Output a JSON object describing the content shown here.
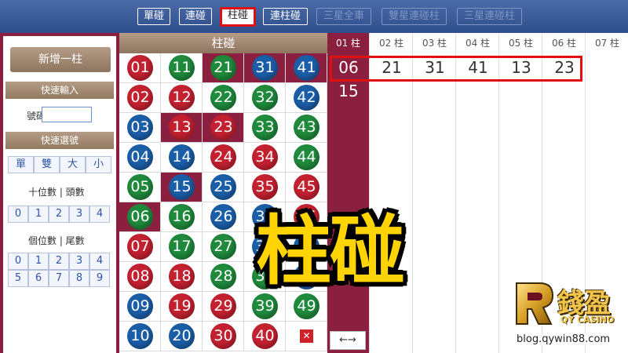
{
  "tabs": [
    {
      "label": "單碰",
      "state": "normal"
    },
    {
      "label": "連碰",
      "state": "normal"
    },
    {
      "label": "柱碰",
      "state": "active"
    },
    {
      "label": "連柱碰",
      "state": "normal"
    },
    {
      "label": "三星全車",
      "state": "disabled"
    },
    {
      "label": "雙星連碰柱",
      "state": "disabled"
    },
    {
      "label": "三星連碰柱",
      "state": "disabled"
    }
  ],
  "left": {
    "add_button": "新增一柱",
    "quick_input_title": "快速輸入",
    "number_label": "號碼",
    "number_value": "",
    "quick_pick_title": "快速選號",
    "parity_buttons": [
      "單",
      "雙",
      "大",
      "小"
    ],
    "tens_label": "十位數 | 頭數",
    "tens_buttons": [
      "0",
      "1",
      "2",
      "3",
      "4"
    ],
    "units_label": "個位數 | 尾數",
    "units_buttons": [
      "0",
      "1",
      "2",
      "3",
      "4",
      "5",
      "6",
      "7",
      "8",
      "9"
    ]
  },
  "grid": {
    "title": "柱碰",
    "rows": [
      [
        {
          "n": "01",
          "c": "red"
        },
        {
          "n": "11",
          "c": "green"
        },
        {
          "n": "21",
          "c": "green",
          "sel": true
        },
        {
          "n": "31",
          "c": "blue",
          "sel": true
        },
        {
          "n": "41",
          "c": "blue",
          "sel": true
        }
      ],
      [
        {
          "n": "02",
          "c": "red"
        },
        {
          "n": "12",
          "c": "red"
        },
        {
          "n": "22",
          "c": "green"
        },
        {
          "n": "32",
          "c": "green"
        },
        {
          "n": "42",
          "c": "blue"
        }
      ],
      [
        {
          "n": "03",
          "c": "blue"
        },
        {
          "n": "13",
          "c": "red",
          "sel": true
        },
        {
          "n": "23",
          "c": "red",
          "sel": true
        },
        {
          "n": "33",
          "c": "green"
        },
        {
          "n": "43",
          "c": "green"
        }
      ],
      [
        {
          "n": "04",
          "c": "blue"
        },
        {
          "n": "14",
          "c": "blue"
        },
        {
          "n": "24",
          "c": "red"
        },
        {
          "n": "34",
          "c": "red"
        },
        {
          "n": "44",
          "c": "green"
        }
      ],
      [
        {
          "n": "05",
          "c": "green"
        },
        {
          "n": "15",
          "c": "blue",
          "sel": true
        },
        {
          "n": "25",
          "c": "blue"
        },
        {
          "n": "35",
          "c": "red"
        },
        {
          "n": "45",
          "c": "red"
        }
      ],
      [
        {
          "n": "06",
          "c": "green",
          "sel": true
        },
        {
          "n": "16",
          "c": "green"
        },
        {
          "n": "26",
          "c": "blue"
        },
        {
          "n": "36",
          "c": "blue"
        },
        {
          "n": "46",
          "c": "red"
        }
      ],
      [
        {
          "n": "07",
          "c": "red"
        },
        {
          "n": "17",
          "c": "green"
        },
        {
          "n": "27",
          "c": "green"
        },
        {
          "n": "37",
          "c": "blue"
        },
        {
          "n": "47",
          "c": "blue"
        }
      ],
      [
        {
          "n": "08",
          "c": "red"
        },
        {
          "n": "18",
          "c": "red"
        },
        {
          "n": "28",
          "c": "green"
        },
        {
          "n": "38",
          "c": "green"
        },
        {
          "n": "48",
          "c": "blue"
        }
      ],
      [
        {
          "n": "09",
          "c": "blue"
        },
        {
          "n": "19",
          "c": "red"
        },
        {
          "n": "29",
          "c": "red"
        },
        {
          "n": "39",
          "c": "green"
        },
        {
          "n": "49",
          "c": "green"
        }
      ],
      [
        {
          "n": "10",
          "c": "blue"
        },
        {
          "n": "20",
          "c": "blue"
        },
        {
          "n": "30",
          "c": "red"
        },
        {
          "n": "40",
          "c": "red"
        },
        {
          "n": "",
          "c": "delete"
        }
      ]
    ]
  },
  "columns": {
    "headers": [
      "01 柱",
      "02 柱",
      "03 柱",
      "04 柱",
      "05 柱",
      "06 柱",
      "07 柱"
    ],
    "picks": [
      [
        "06",
        "15"
      ],
      [
        "21"
      ],
      [
        "31"
      ],
      [
        "41"
      ],
      [
        "13"
      ],
      [
        "23"
      ],
      []
    ]
  },
  "arrows": "←→",
  "overlay_title": "柱碰",
  "logo": {
    "name": "錢盈",
    "sub": "QY CASINO",
    "url": "blog.qywin88.com"
  },
  "colors": {
    "accent": "#8a1f3f",
    "highlight": "#e01010",
    "title": "#ffd400"
  }
}
